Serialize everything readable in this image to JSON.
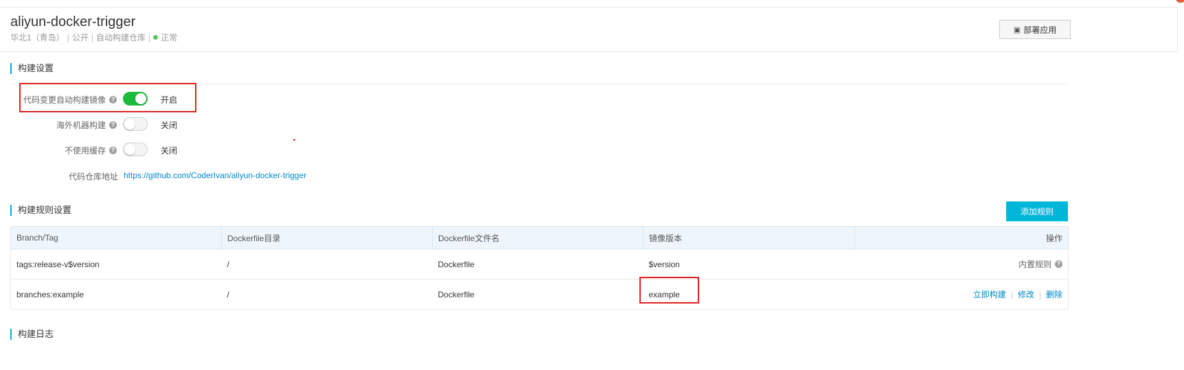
{
  "header": {
    "title": "aliyun-docker-trigger",
    "region": "华北1（青岛）",
    "visibility": "公开",
    "repo_type": "自动构建仓库",
    "status": "正常",
    "deploy_button": "部署应用"
  },
  "build_settings": {
    "section_title": "构建设置",
    "auto_build": {
      "label": "代码变更自动构建镜像",
      "state_text": "开启",
      "on": true
    },
    "overseas_build": {
      "label": "海外机器构建",
      "state_text": "关闭",
      "on": false
    },
    "no_cache": {
      "label": "不使用缓存",
      "state_text": "关闭",
      "on": false
    },
    "repo_address": {
      "label": "代码仓库地址",
      "url": "https://github.com/CoderIvan/aliyun-docker-trigger"
    }
  },
  "build_rules": {
    "section_title": "构建规则设置",
    "add_button": "添加规则",
    "columns": [
      "Branch/Tag",
      "Dockerfile目录",
      "Dockerfile文件名",
      "镜像版本",
      "操作"
    ],
    "rows": [
      {
        "branch_tag": "tags:release-v$version",
        "dir": "/",
        "filename": "Dockerfile",
        "version": "$version",
        "action": "内置规则"
      },
      {
        "branch_tag": "branches:example",
        "dir": "/",
        "filename": "Dockerfile",
        "version": "example",
        "actions": [
          "立即构建",
          "修改",
          "删除"
        ]
      }
    ]
  },
  "build_log": {
    "section_title": "构建日志"
  },
  "colors": {
    "accent": "#00b6d9",
    "toggle_on": "#1dbb3c",
    "link": "#0088cc",
    "highlight": "#e02020"
  }
}
